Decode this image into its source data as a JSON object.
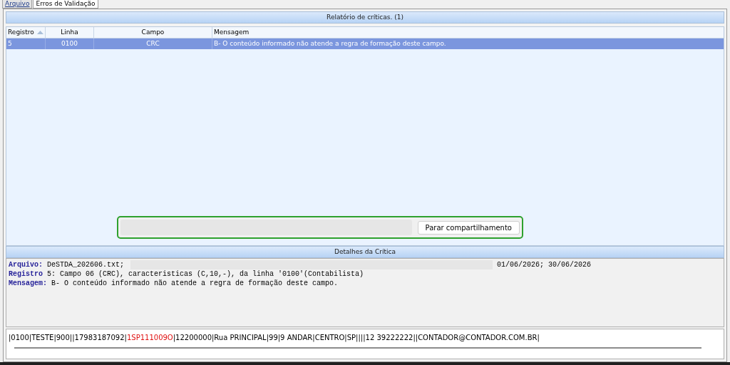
{
  "tabs": [
    {
      "label": "Arquivo",
      "selected": false
    },
    {
      "label": "Erros de Validação",
      "selected": true
    }
  ],
  "report": {
    "title": "Relatório de críticas. (1)",
    "columns": [
      {
        "label": "Registro",
        "sorted": true
      },
      {
        "label": "Linha",
        "sorted": false
      },
      {
        "label": "Campo",
        "sorted": false
      },
      {
        "label": "Mensagem",
        "sorted": false
      }
    ],
    "rows": [
      {
        "selected": true,
        "cells": [
          "5",
          "0100",
          "CRC",
          "B- O conteúdo informado não atende a regra de formação deste campo."
        ]
      }
    ]
  },
  "sharing_bar": {
    "button": "Parar compartilhamento"
  },
  "details": {
    "title": "Detalhes da Crítica",
    "lines": [
      {
        "label": "Arquivo:",
        "text": "DeSTDA_202606.txt;",
        "extra": "01/06/2026; 30/06/2026"
      },
      {
        "label": "Registro",
        "text": "5: Campo 06 (CRC), caracteristicas (C,10,-), da linha '0100'(Contabilista)"
      },
      {
        "label": "Mensagem:",
        "text": "B- O conteúdo informado não atende a regra de formação deste campo."
      }
    ]
  },
  "record_line": [
    {
      "text": "|0100|TESTE|900||17983187092|",
      "error": false
    },
    {
      "text": "1SP111009O",
      "error": true
    },
    {
      "text": "|12200000|Rua PRINCIPAL|99|9 ANDAR|CENTRO|SP||||12 39222222||CONTADOR@CONTADOR.COM.BR|",
      "error": false
    }
  ]
}
